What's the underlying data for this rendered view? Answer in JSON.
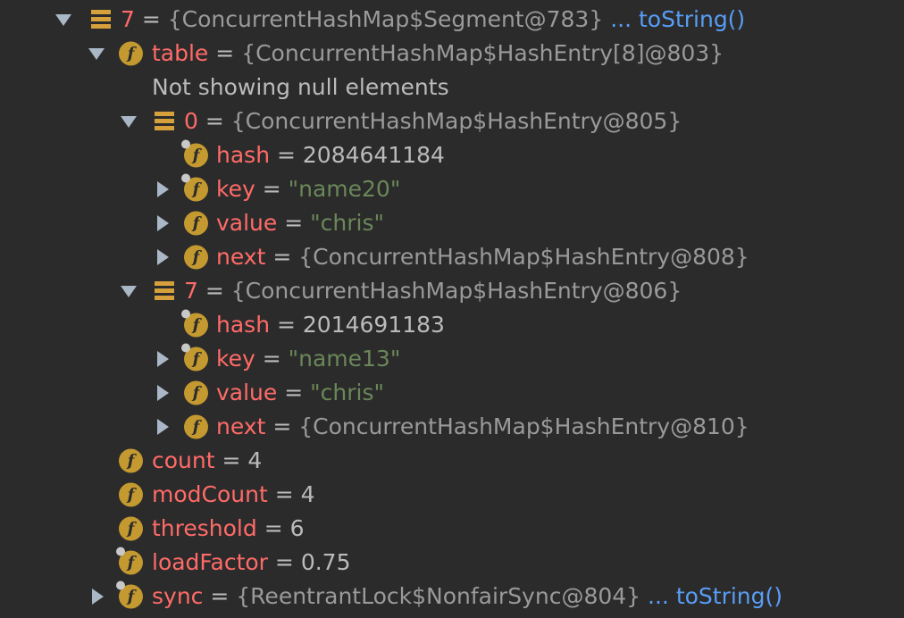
{
  "tree": {
    "nodes": [
      {
        "arrow": "expanded",
        "icon": "array",
        "final": false,
        "name": "7",
        "value": "{ConcurrentHashMap$Segment@783}",
        "vtype": "obj",
        "link": "... toString()"
      },
      {
        "arrow": "expanded",
        "icon": "field",
        "final": false,
        "name": "table",
        "value": "{ConcurrentHashMap$HashEntry[8]@803}",
        "vtype": "obj",
        "link": ""
      },
      {
        "arrow": "none",
        "icon": "none",
        "final": false,
        "name": "",
        "value": "Not showing null elements",
        "vtype": "msg",
        "link": ""
      },
      {
        "arrow": "expanded",
        "icon": "array",
        "final": false,
        "name": "0",
        "value": "{ConcurrentHashMap$HashEntry@805}",
        "vtype": "obj",
        "link": ""
      },
      {
        "arrow": "none",
        "icon": "field",
        "final": true,
        "name": "hash",
        "value": "2084641184",
        "vtype": "num",
        "link": ""
      },
      {
        "arrow": "collapsed",
        "icon": "field",
        "final": true,
        "name": "key",
        "value": "\"name20\"",
        "vtype": "str",
        "link": ""
      },
      {
        "arrow": "collapsed",
        "icon": "field",
        "final": false,
        "name": "value",
        "value": "\"chris\"",
        "vtype": "str",
        "link": ""
      },
      {
        "arrow": "collapsed",
        "icon": "field",
        "final": false,
        "name": "next",
        "value": "{ConcurrentHashMap$HashEntry@808}",
        "vtype": "obj",
        "link": ""
      },
      {
        "arrow": "expanded",
        "icon": "array",
        "final": false,
        "name": "7",
        "value": "{ConcurrentHashMap$HashEntry@806}",
        "vtype": "obj",
        "link": ""
      },
      {
        "arrow": "none",
        "icon": "field",
        "final": true,
        "name": "hash",
        "value": "2014691183",
        "vtype": "num",
        "link": ""
      },
      {
        "arrow": "collapsed",
        "icon": "field",
        "final": true,
        "name": "key",
        "value": "\"name13\"",
        "vtype": "str",
        "link": ""
      },
      {
        "arrow": "collapsed",
        "icon": "field",
        "final": false,
        "name": "value",
        "value": "\"chris\"",
        "vtype": "str",
        "link": ""
      },
      {
        "arrow": "collapsed",
        "icon": "field",
        "final": false,
        "name": "next",
        "value": "{ConcurrentHashMap$HashEntry@810}",
        "vtype": "obj",
        "link": ""
      },
      {
        "arrow": "none",
        "icon": "field",
        "final": false,
        "name": "count",
        "value": "4",
        "vtype": "num",
        "link": ""
      },
      {
        "arrow": "none",
        "icon": "field",
        "final": false,
        "name": "modCount",
        "value": "4",
        "vtype": "num",
        "link": ""
      },
      {
        "arrow": "none",
        "icon": "field",
        "final": false,
        "name": "threshold",
        "value": "6",
        "vtype": "num",
        "link": ""
      },
      {
        "arrow": "none",
        "icon": "field",
        "final": true,
        "name": "loadFactor",
        "value": "0.75",
        "vtype": "num",
        "link": ""
      },
      {
        "arrow": "collapsed",
        "icon": "field",
        "final": true,
        "name": "sync",
        "value": "{ReentrantLock$NonfairSync@804}",
        "vtype": "obj",
        "link": "... toString()"
      }
    ]
  }
}
